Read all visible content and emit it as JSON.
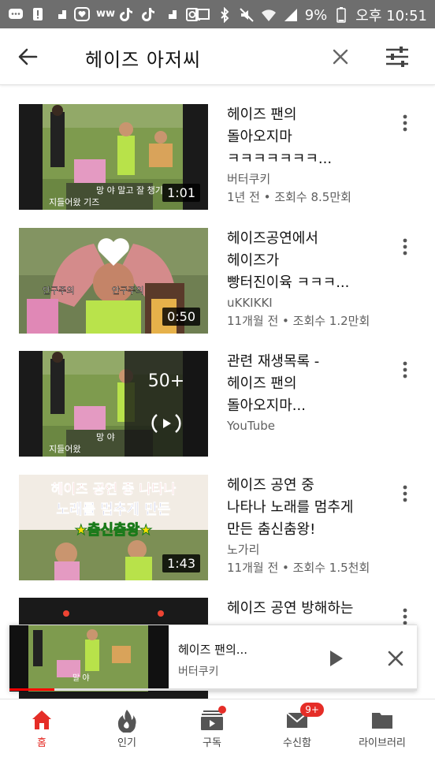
{
  "status_bar": {
    "battery": "9%",
    "time": "오후 10:51"
  },
  "search": {
    "query": "헤이즈 아저씨"
  },
  "results": [
    {
      "title_lines": [
        "헤이즈 팬의",
        "돌아오지마",
        "ㅋㅋㅋㅋㅋㅋㅋ..."
      ],
      "channel": "버터쿠키",
      "stats": "1년 전 • 조회수 8.5만회",
      "duration": "1:01"
    },
    {
      "title_lines": [
        "헤이즈공연에서",
        "헤이즈가",
        "빵터진이육 ㅋㅋㅋ..."
      ],
      "channel": "uKKIKKI",
      "stats": "11개월 전 • 조회수 1.2만회",
      "duration": "0:50",
      "overlay_texts": [
        "안구주의",
        "안구주의"
      ]
    },
    {
      "title_lines": [
        "관련 재생목록 -",
        "헤이즈 팬의",
        "돌아오지마..."
      ],
      "channel": "YouTube",
      "playlist_count": "50+"
    },
    {
      "title_lines": [
        "헤이즈 공연 중",
        "나타나 노래를 멈추게",
        "만든 춤신춤왕!"
      ],
      "channel": "노가리",
      "stats": "11개월 전 • 조회수 1.5천회",
      "duration": "1:43",
      "thumb_text_lines": [
        "헤이즈 공연 중 나타나",
        "노래를 멈추게 만든",
        "★춤신춤왕★"
      ]
    },
    {
      "title_lines": [
        "헤이즈 공연 방해하는"
      ]
    }
  ],
  "mini_player": {
    "title": "헤이즈 팬의...",
    "channel": "버터쿠키",
    "progress_fraction": 0.11
  },
  "bottom_nav": [
    {
      "label": "홈",
      "icon": "home-icon",
      "active": true
    },
    {
      "label": "인기",
      "icon": "fire-icon"
    },
    {
      "label": "구독",
      "icon": "subscriptions-icon",
      "dot": true
    },
    {
      "label": "수신함",
      "icon": "inbox-icon",
      "badge": "9+"
    },
    {
      "label": "라이브러리",
      "icon": "library-icon"
    }
  ],
  "colors": {
    "accent": "#e52d27",
    "status_bar": "#6e6e6e"
  }
}
